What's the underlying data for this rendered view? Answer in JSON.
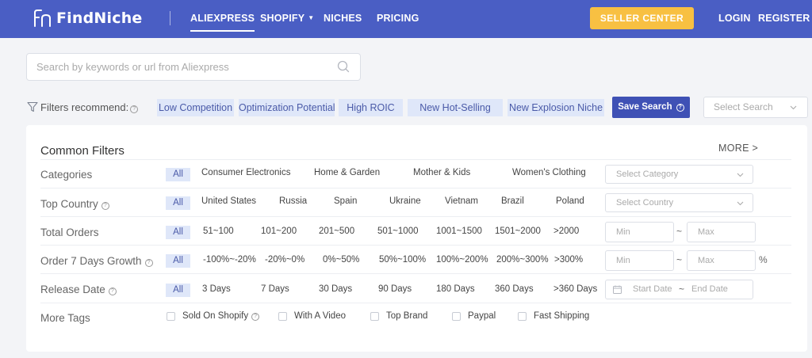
{
  "brand": {
    "name": "FindNiche"
  },
  "nav": {
    "links": [
      "ALIEXPRESS",
      "SHOPIFY",
      "NICHES",
      "PRICING"
    ],
    "seller_center": "SELLER CENTER",
    "login": "LOGIN",
    "register": "REGISTER"
  },
  "search": {
    "placeholder": "Search by keywords or url from Aliexpress"
  },
  "recommend": {
    "label": "Filters recommend:",
    "tags": [
      "Low Competition",
      "Optimization Potential",
      "High ROIC",
      "New Hot-Selling",
      "New Explosion Niche"
    ],
    "save_search": "Save Search",
    "select_search": "Select Search"
  },
  "filters": {
    "title": "Common Filters",
    "more": "MORE >",
    "categories": {
      "label": "Categories",
      "all": "All",
      "options": [
        "Consumer Electronics",
        "Home & Garden",
        "Mother & Kids",
        "Women's Clothing"
      ],
      "select_placeholder": "Select Category"
    },
    "top_country": {
      "label": "Top Country",
      "all": "All",
      "options": [
        "United States",
        "Russia",
        "Spain",
        "Ukraine",
        "Vietnam",
        "Brazil",
        "Poland"
      ],
      "select_placeholder": "Select Country"
    },
    "total_orders": {
      "label": "Total Orders",
      "all": "All",
      "options": [
        "51~100",
        "101~200",
        "201~500",
        "501~1000",
        "1001~1500",
        "1501~2000",
        ">2000"
      ],
      "min_placeholder": "Min",
      "max_placeholder": "Max"
    },
    "growth": {
      "label": "Order 7 Days Growth",
      "all": "All",
      "options": [
        "-100%~-20%",
        "-20%~0%",
        "0%~50%",
        "50%~100%",
        "100%~200%",
        "200%~300%",
        ">300%"
      ],
      "min_placeholder": "Min",
      "max_placeholder": "Max",
      "unit": "%"
    },
    "release_date": {
      "label": "Release Date",
      "all": "All",
      "options": [
        "3 Days",
        "7 Days",
        "30 Days",
        "90 Days",
        "180 Days",
        "360 Days",
        ">360 Days"
      ],
      "start_placeholder": "Start Date",
      "end_placeholder": "End Date"
    },
    "more_tags": {
      "label": "More Tags",
      "options": [
        "Sold On Shopify",
        "With A Video",
        "Top Brand",
        "Paypal",
        "Fast Shipping"
      ]
    },
    "tilde": "~"
  },
  "colors": {
    "nav_bg": "#4a5ec4",
    "seller_btn": "#f8c042",
    "save_btn": "#3f51b5",
    "tag_bg": "#dfe7f9",
    "tag_text": "#4a5aa8"
  }
}
